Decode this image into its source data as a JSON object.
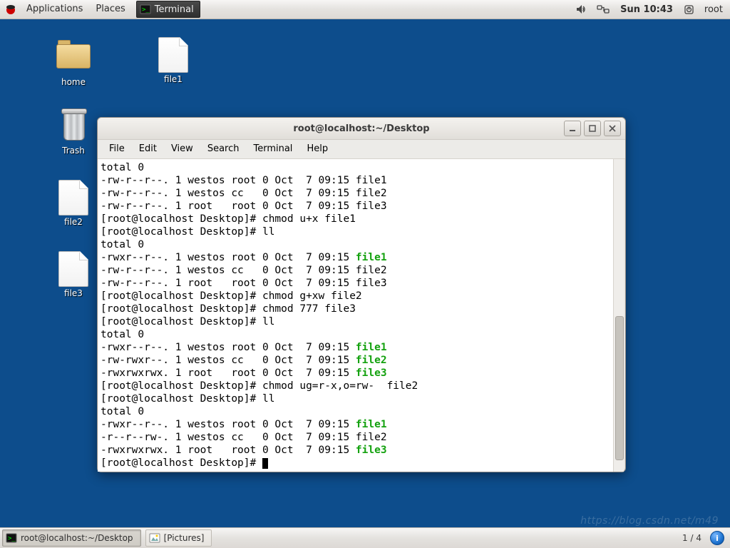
{
  "top_panel": {
    "applications": "Applications",
    "places": "Places",
    "task_terminal": "Terminal",
    "clock": "Sun 10:43",
    "user": "root"
  },
  "desktop_icons": {
    "home": "home",
    "file1": "file1",
    "trash": "Trash",
    "file2": "file2",
    "file3": "file3"
  },
  "terminal": {
    "title": "root@localhost:~/Desktop",
    "menu": {
      "file": "File",
      "edit": "Edit",
      "view": "View",
      "search": "Search",
      "terminal": "Terminal",
      "help": "Help"
    },
    "lines": [
      {
        "t": "total 0"
      },
      {
        "t": "-rw-r--r--. 1 westos root 0 Oct  7 09:15 file1"
      },
      {
        "t": "-rw-r--r--. 1 westos cc   0 Oct  7 09:15 file2"
      },
      {
        "t": "-rw-r--r--. 1 root   root 0 Oct  7 09:15 file3"
      },
      {
        "t": "[root@localhost Desktop]# chmod u+x file1"
      },
      {
        "t": "[root@localhost Desktop]# ll"
      },
      {
        "t": "total 0"
      },
      {
        "p": "-rwxr--r--. 1 westos root 0 Oct  7 09:15 ",
        "f": "file1"
      },
      {
        "t": "-rw-r--r--. 1 westos cc   0 Oct  7 09:15 file2"
      },
      {
        "t": "-rw-r--r--. 1 root   root 0 Oct  7 09:15 file3"
      },
      {
        "t": "[root@localhost Desktop]# chmod g+xw file2"
      },
      {
        "t": "[root@localhost Desktop]# chmod 777 file3"
      },
      {
        "t": "[root@localhost Desktop]# ll"
      },
      {
        "t": "total 0"
      },
      {
        "p": "-rwxr--r--. 1 westos root 0 Oct  7 09:15 ",
        "f": "file1"
      },
      {
        "p": "-rw-rwxr--. 1 westos cc   0 Oct  7 09:15 ",
        "f": "file2"
      },
      {
        "p": "-rwxrwxrwx. 1 root   root 0 Oct  7 09:15 ",
        "f": "file3"
      },
      {
        "t": "[root@localhost Desktop]# chmod ug=r-x,o=rw-  file2"
      },
      {
        "t": "[root@localhost Desktop]# ll"
      },
      {
        "t": "total 0"
      },
      {
        "p": "-rwxr--r--. 1 westos root 0 Oct  7 09:15 ",
        "f": "file1"
      },
      {
        "t": "-r--r--rw-. 1 westos cc   0 Oct  7 09:15 file2"
      },
      {
        "p": "-rwxrwxrwx. 1 root   root 0 Oct  7 09:15 ",
        "f": "file3"
      },
      {
        "t": "[root@localhost Desktop]# ",
        "cursor": true
      }
    ]
  },
  "bottom_panel": {
    "task_terminal": "root@localhost:~/Desktop",
    "task_pictures": "[Pictures]",
    "workspace": "1 / 4"
  },
  "watermark": "https://blog.csdn.net/m49"
}
